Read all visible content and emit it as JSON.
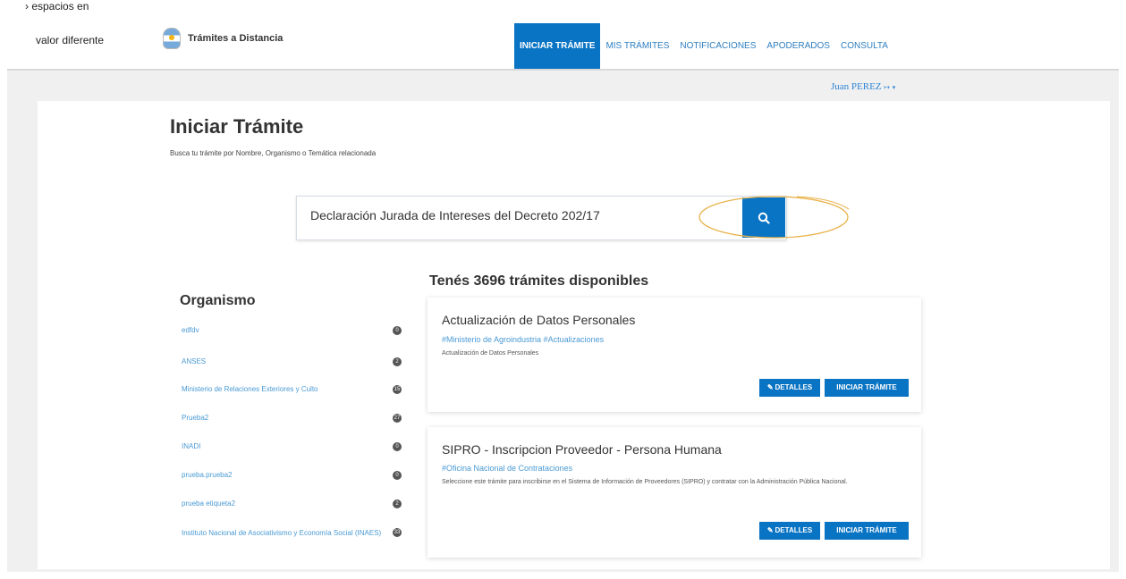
{
  "header": {
    "cut_text_1": "› espacios en",
    "cut_text_2": "valor diferente",
    "brand": "Trámites a Distancia",
    "nav": [
      "INICIAR TRÁMITE",
      "MIS TRÁMITES",
      "NOTIFICACIONES",
      "APODERADOS",
      "CONSULTA"
    ],
    "active_nav": "INICIAR TRÁMITE",
    "user": "Juan PEREZ"
  },
  "page": {
    "title": "Iniciar Trámite",
    "subtitle": "Busca tu trámite por Nombre, Organismo o Temática relacionada"
  },
  "search": {
    "value": "Declaración Jurada de Intereses del Decreto 202/17",
    "button_icon": "search-icon"
  },
  "organismo": {
    "title": "Organismo",
    "items": [
      {
        "label": "edfdv",
        "count": "0"
      },
      {
        "label": "ANSES",
        "count": "2"
      },
      {
        "label": "Ministerio de Relaciones Exteriores y Culto",
        "count": "15"
      },
      {
        "label": "Prueba2",
        "count": "27"
      },
      {
        "label": "INADI",
        "count": "0"
      },
      {
        "label": "prueba.prueba2",
        "count": "0"
      },
      {
        "label": "prueba etiqueta2",
        "count": "2"
      },
      {
        "label": "Instituto Nacional de Asociativismo y Economía Social (INAES)",
        "count": "33"
      }
    ]
  },
  "results": {
    "title": "Tenés 3696 trámites disponibles",
    "cards": [
      {
        "title": "Actualización de Datos Personales",
        "tags": "#Ministerio de Agroindustria #Actualizaciones",
        "description": "Actualización de Datos Personales",
        "details_label": "DETALLES",
        "start_label": "INICIAR TRÁMITE"
      },
      {
        "title": "SIPRO - Inscripcion Proveedor - Persona Humana",
        "tags": "#Oficina Nacional de Contrataciones",
        "description": "Seleccione este trámite para inscribirse en el Sistema de Información de Proveedores (SIPRO) y contratar con la Administración Pública Nacional.",
        "details_label": "DETALLES",
        "start_label": "INICIAR TRÁMITE"
      }
    ]
  },
  "colors": {
    "primary": "#0a74c4",
    "link": "#4a9ad4",
    "annotation": "#e8b24a"
  }
}
